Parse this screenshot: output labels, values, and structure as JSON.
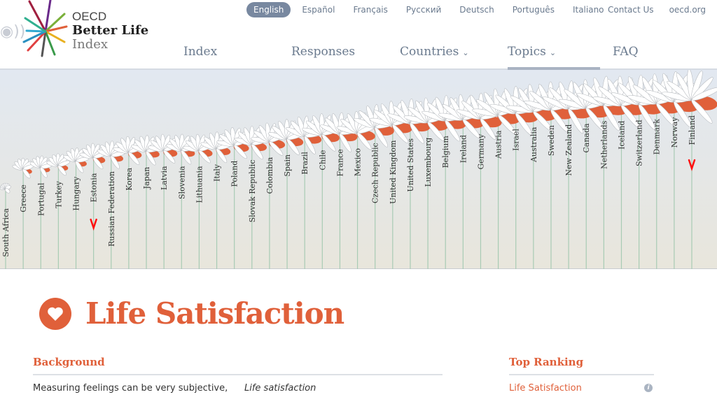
{
  "logo": {
    "line1": "OECD",
    "line2": "Better Life",
    "line3": "Index"
  },
  "languages": [
    {
      "label": "English",
      "active": true
    },
    {
      "label": "Español"
    },
    {
      "label": "Français"
    },
    {
      "label": "Русский"
    },
    {
      "label": "Deutsch"
    },
    {
      "label": "Português"
    },
    {
      "label": "Italiano"
    }
  ],
  "utility": {
    "contact": "Contact Us",
    "oecd": "oecd.org"
  },
  "nav": {
    "index": "Index",
    "responses": "Responses",
    "countries": "Countries",
    "topics": "Topics",
    "faq": "FAQ",
    "active": "Topics"
  },
  "colors": {
    "accent": "#e0603a",
    "nav": "#6a7a8e",
    "stem": "#a8cbb4",
    "marker": "#ff1010"
  },
  "chart_data": {
    "type": "ranking-flowers",
    "countries": [
      "South Africa",
      "Greece",
      "Portugal",
      "Turkey",
      "Hungary",
      "Estonia",
      "Russian Federation",
      "Korea",
      "Japan",
      "Latvia",
      "Slovenia",
      "Lithuania",
      "Italy",
      "Poland",
      "Slovak Republic",
      "Colombia",
      "Spain",
      "Brazil",
      "Chile",
      "France",
      "Mexico",
      "Czech Republic",
      "United Kingdom",
      "United States",
      "Luxembourg",
      "Belgium",
      "Ireland",
      "Germany",
      "Austria",
      "Israel",
      "Australia",
      "Sweden",
      "New Zealand",
      "Canada",
      "Netherlands",
      "Iceland",
      "Switzerland",
      "Denmark",
      "Norway",
      "Finland"
    ],
    "relative_level": [
      0.0,
      0.22,
      0.24,
      0.26,
      0.31,
      0.35,
      0.37,
      0.41,
      0.42,
      0.43,
      0.43,
      0.43,
      0.45,
      0.49,
      0.5,
      0.53,
      0.56,
      0.59,
      0.61,
      0.62,
      0.63,
      0.69,
      0.72,
      0.74,
      0.75,
      0.77,
      0.78,
      0.79,
      0.83,
      0.85,
      0.87,
      0.89,
      0.9,
      0.91,
      0.94,
      0.94,
      0.95,
      0.96,
      0.98,
      1.0
    ],
    "marked": [
      "Estonia",
      "Finland"
    ]
  },
  "topic": {
    "title": "Life Satisfaction",
    "icon": "heart-icon"
  },
  "background": {
    "heading": "Background",
    "text": "Measuring feelings can be very subjective,",
    "text2": "Life satisfaction"
  },
  "ranking": {
    "heading": "Top Ranking",
    "item": "Life Satisfaction",
    "info": "i"
  }
}
